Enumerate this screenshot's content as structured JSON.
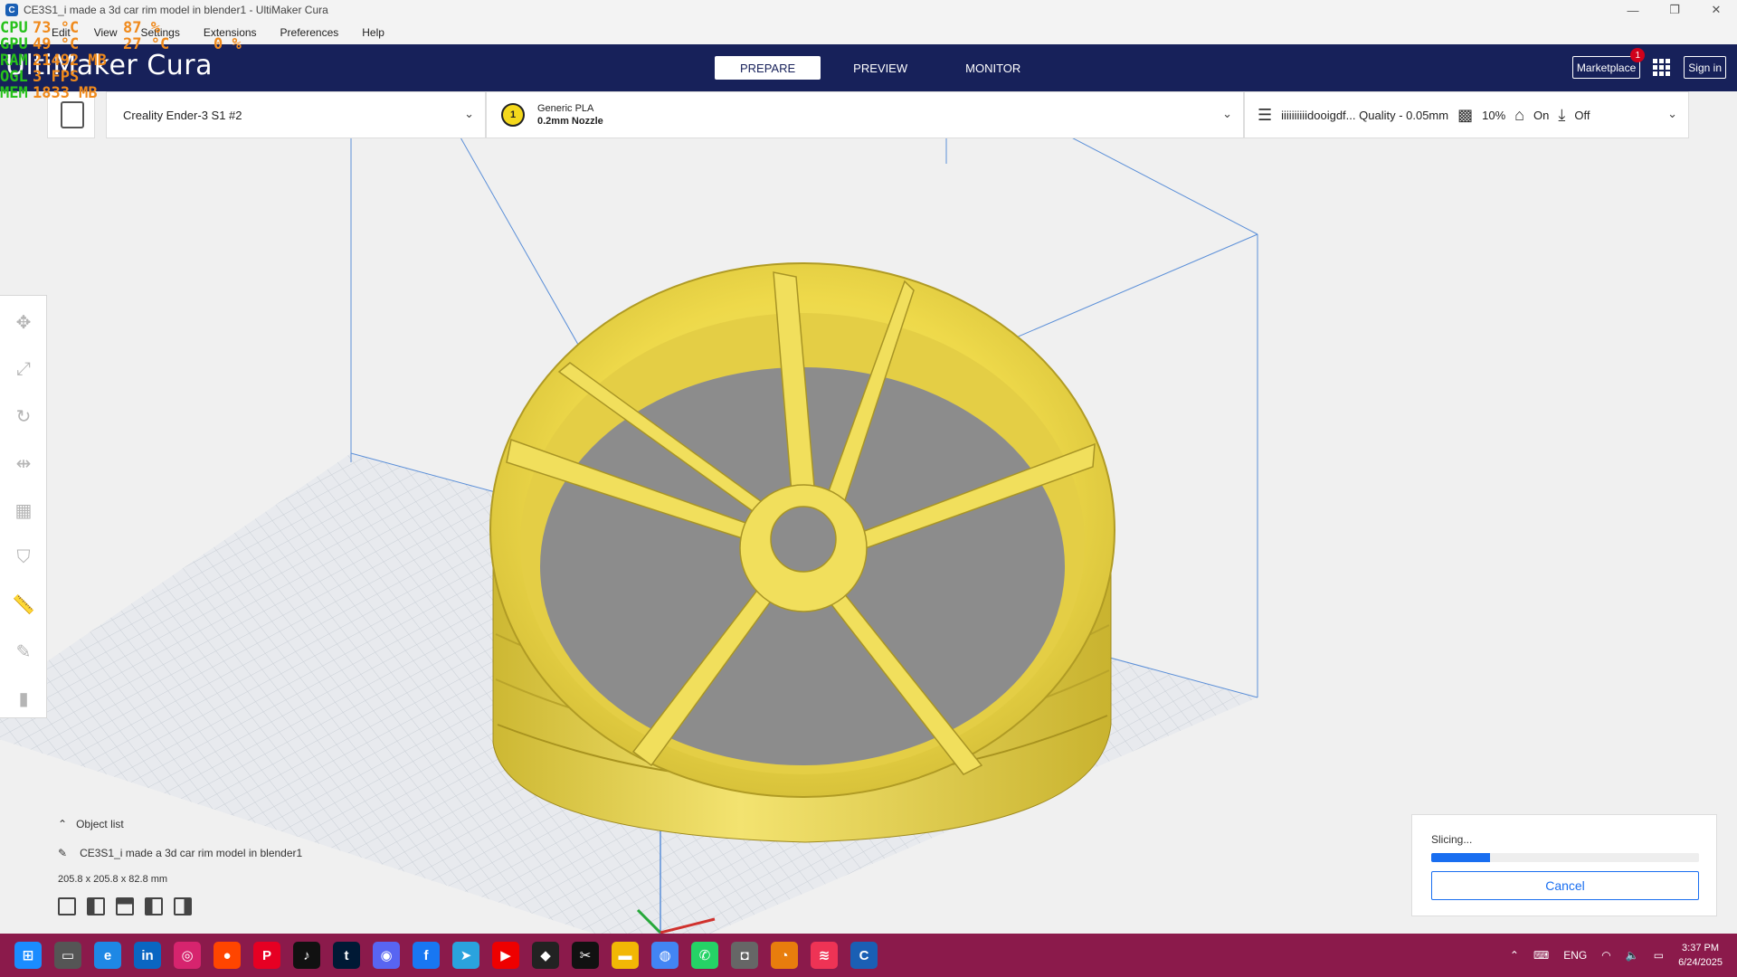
{
  "window": {
    "title": "CE3S1_i made a 3d car rim model in blender1 - UltiMaker Cura",
    "minimize": "—",
    "maximize": "❐",
    "close": "✕"
  },
  "menu": [
    "Edit",
    "View",
    "Settings",
    "Extensions",
    "Preferences",
    "Help"
  ],
  "perf_overlay": [
    {
      "label": "CPU",
      "v1": "73 °C",
      "v2": "87 %",
      "v3": ""
    },
    {
      "label": "GPU",
      "v1": "49 °C",
      "v2": "27 °C",
      "v3": "0 %"
    },
    {
      "label": "RAM",
      "v1": "21492 MB",
      "v2": "",
      "v3": ""
    },
    {
      "label": "OGL",
      "v1": "3 FPS",
      "v2": "",
      "v3": ""
    },
    {
      "label": "MEM",
      "v1": "1833 MB",
      "v2": "",
      "v3": ""
    }
  ],
  "header": {
    "logo_light": "UltiMaker",
    "logo_bold": "",
    "logo_suffix": " Cura",
    "tabs": [
      {
        "label": "PREPARE",
        "active": true
      },
      {
        "label": "PREVIEW",
        "active": false
      },
      {
        "label": "MONITOR",
        "active": false
      }
    ],
    "marketplace_label": "Marketplace",
    "marketplace_badge": "1",
    "signin_label": "Sign in"
  },
  "machine": {
    "printer": "Creality Ender-3 S1 #2",
    "extruder_number": "1",
    "material": "Generic PLA",
    "nozzle": "0.2mm Nozzle",
    "profile": "iiiiiiiiiidooigdf... Quality - 0.05mm",
    "infill": "10%",
    "support": "On",
    "adhesion": "Off"
  },
  "tools": [
    {
      "name": "move-tool",
      "glyph": "✥",
      "active": false
    },
    {
      "name": "scale-tool",
      "glyph": "⤢",
      "active": false
    },
    {
      "name": "rotate-tool",
      "glyph": "↻",
      "active": false
    },
    {
      "name": "mirror-tool",
      "glyph": "⇹",
      "active": false
    },
    {
      "name": "per-model-settings-tool",
      "glyph": "▦",
      "active": false
    },
    {
      "name": "support-blocker-tool",
      "glyph": "⛉",
      "active": false
    },
    {
      "name": "measure-tool",
      "glyph": "📏",
      "active": true
    },
    {
      "name": "paint-tool",
      "glyph": "✎",
      "active": false
    },
    {
      "name": "cylinder-tool",
      "glyph": "▮",
      "active": false
    }
  ],
  "object_list": {
    "header": "Object list",
    "item": "CE3S1_i made a 3d car rim model in blender1",
    "dims": "205.8 x 205.8 x 82.8 mm"
  },
  "slicing": {
    "status": "Slicing...",
    "progress_percent": 22,
    "cancel_label": "Cancel"
  },
  "taskbar": {
    "time": "3:37 PM",
    "date": "6/24/2025",
    "lang": "ENG",
    "apps": [
      {
        "name": "windows-start-icon",
        "bg": "#1a8cff",
        "glyph": "⊞"
      },
      {
        "name": "task-view-icon",
        "bg": "#555",
        "glyph": "▭"
      },
      {
        "name": "edge-icon",
        "bg": "#1e88e5",
        "glyph": "e"
      },
      {
        "name": "linkedin-icon",
        "bg": "#0a66c2",
        "glyph": "in"
      },
      {
        "name": "instagram-icon",
        "bg": "#d6246e",
        "glyph": "◎"
      },
      {
        "name": "reddit-icon",
        "bg": "#ff4500",
        "glyph": "●"
      },
      {
        "name": "pinterest-icon",
        "bg": "#e60023",
        "glyph": "P"
      },
      {
        "name": "tiktok-icon",
        "bg": "#111",
        "glyph": "♪"
      },
      {
        "name": "tumblr-icon",
        "bg": "#001935",
        "glyph": "t"
      },
      {
        "name": "discord-icon",
        "bg": "#5865f2",
        "glyph": "◉"
      },
      {
        "name": "facebook-icon",
        "bg": "#1877f2",
        "glyph": "f"
      },
      {
        "name": "telegram-icon",
        "bg": "#2aa3de",
        "glyph": "➤"
      },
      {
        "name": "youtube-icon",
        "bg": "#e00",
        "glyph": "▶"
      },
      {
        "name": "unity-icon",
        "bg": "#222",
        "glyph": "◆"
      },
      {
        "name": "capcut-icon",
        "bg": "#111",
        "glyph": "✂"
      },
      {
        "name": "file-explorer-icon",
        "bg": "#f2b705",
        "glyph": "▬"
      },
      {
        "name": "chrome-icon",
        "bg": "#4285f4",
        "glyph": "◍"
      },
      {
        "name": "whatsapp-icon",
        "bg": "#25d366",
        "glyph": "✆"
      },
      {
        "name": "camera-icon",
        "bg": "#666",
        "glyph": "◘"
      },
      {
        "name": "blender-icon",
        "bg": "#e87d0d",
        "glyph": "◔"
      },
      {
        "name": "audio-app-icon",
        "bg": "#e35",
        "glyph": "≋"
      },
      {
        "name": "cura-icon",
        "bg": "#1a5fb4",
        "glyph": "C"
      }
    ]
  },
  "colors": {
    "header_bg": "#17215a",
    "accent": "#196ef0",
    "model": "#f4e35c",
    "taskbar": "#8b1a4b"
  }
}
